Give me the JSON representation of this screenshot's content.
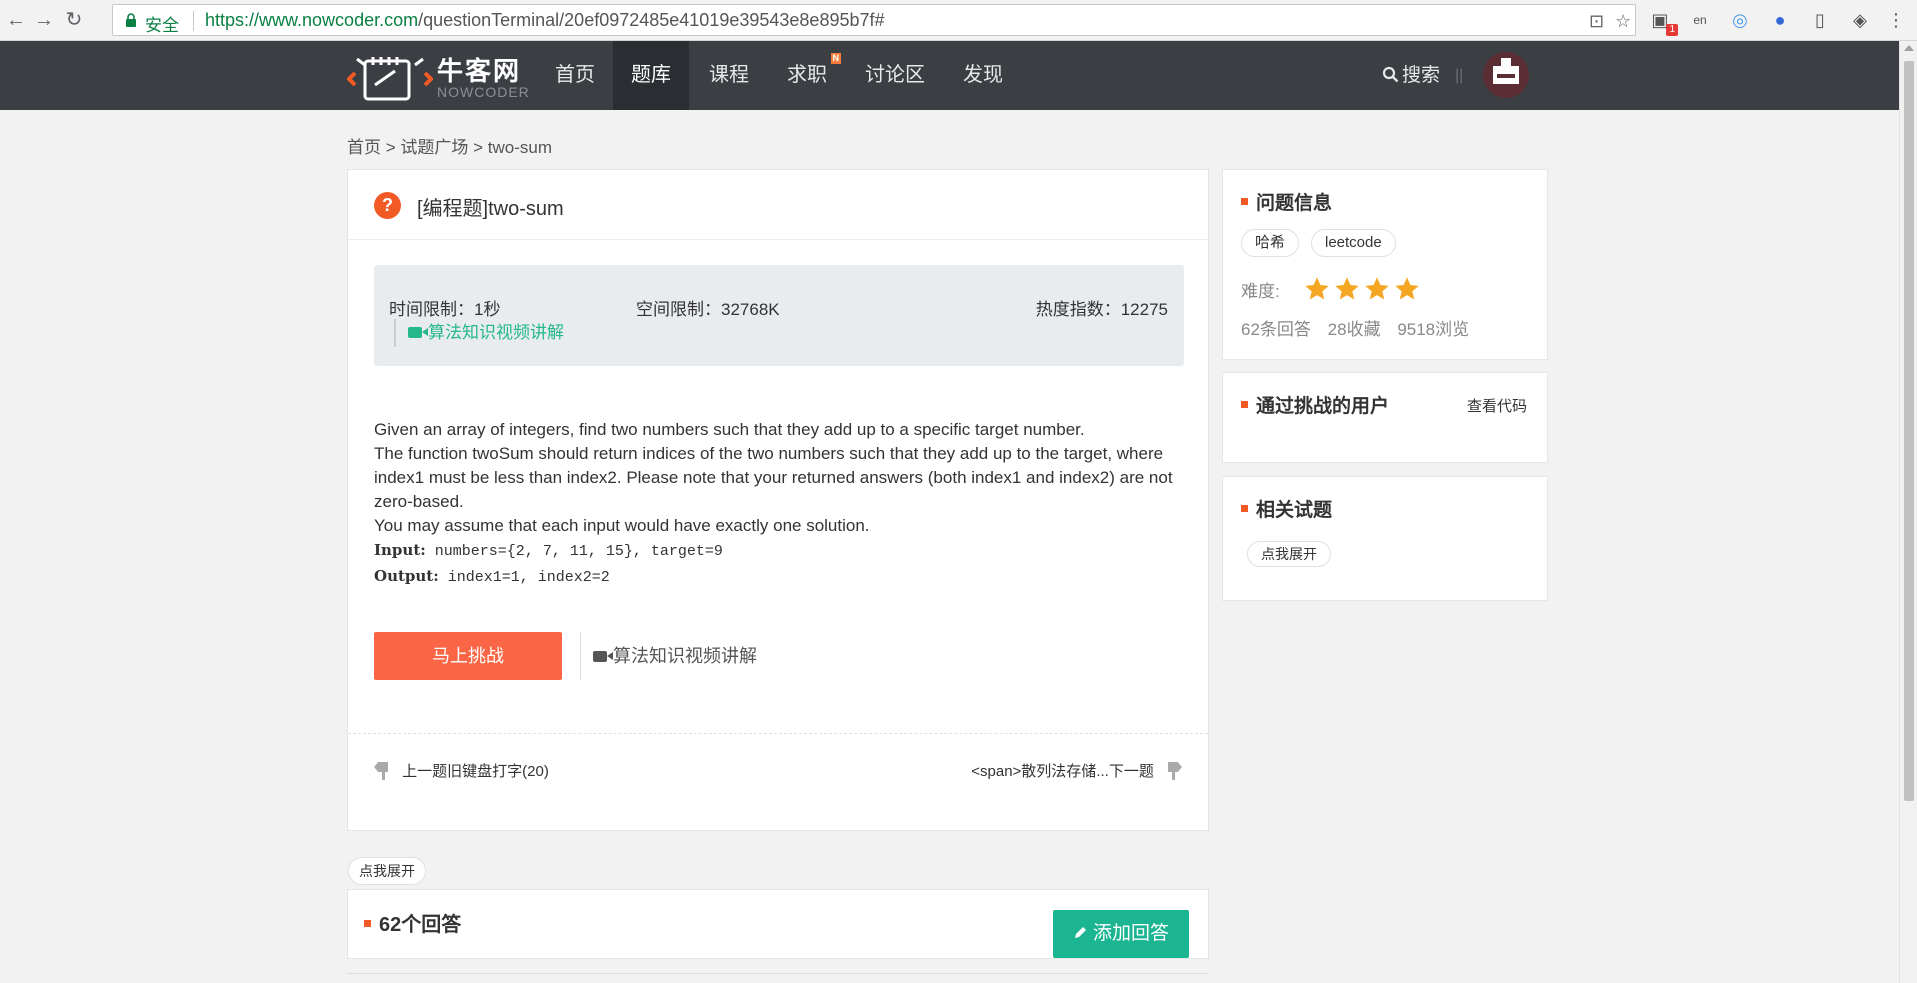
{
  "browser": {
    "secure_label": "安全",
    "url_scheme_host": "https://www.nowcoder.com",
    "url_path": "/questionTerminal/20ef0972485e41019e39543e8e895b7f#",
    "notification_count": "1",
    "ext_lang_label": "en"
  },
  "header": {
    "logo_cn": "牛客网",
    "logo_en": "NOWCODER",
    "nav": [
      "首页",
      "题库",
      "课程",
      "求职",
      "讨论区",
      "发现"
    ],
    "nav_new_badge": "N",
    "search_label": "搜索",
    "divider": "||"
  },
  "breadcrumb": "首页 > 试题广场 > two-sum",
  "question": {
    "icon": "?",
    "title": "[编程题]two-sum",
    "time_limit": "时间限制：1秒",
    "space_limit": "空间限制：32768K",
    "heat_index": "热度指数：12275",
    "video_label": "算法知识视频讲解",
    "description": [
      "Given an array of integers, find two numbers such that they add up to a specific target number.",
      "The function twoSum should return indices of the two numbers such that they add up to the target, where index1 must be less than index2. Please note that your returned answers (both index1 and index2) are not zero-based.",
      "You may assume that each input would have exactly one solution."
    ],
    "input_label": "Input:",
    "input_value": " numbers={2, 7, 11, 15}, target=9",
    "output_label": "Output:",
    "output_value": " index1=1, index2=2",
    "challenge_button": "马上挑战",
    "video_link_2": "算法知识视频讲解",
    "prev_link": "上一题旧键盘打字(20)",
    "next_link": "<span>散列法存储...下一题"
  },
  "expand_label": "点我展开",
  "answers": {
    "title": "62个回答",
    "add_button": "添加回答"
  },
  "sidebar": {
    "info_title": "问题信息",
    "tags": [
      "哈希",
      "leetcode"
    ],
    "difficulty_label": "难度:",
    "difficulty_stars": 4,
    "star_color": "#f5a623",
    "stats": [
      "62条回答",
      "28收藏",
      "9518浏览"
    ],
    "passed_title": "通过挑战的用户",
    "view_code": "查看代码",
    "related_title": "相关试题",
    "related_expand": "点我展开"
  },
  "colors": {
    "accent_orange": "#fa6645",
    "accent_green": "#1bb592",
    "header_bg": "#3b3f44"
  }
}
